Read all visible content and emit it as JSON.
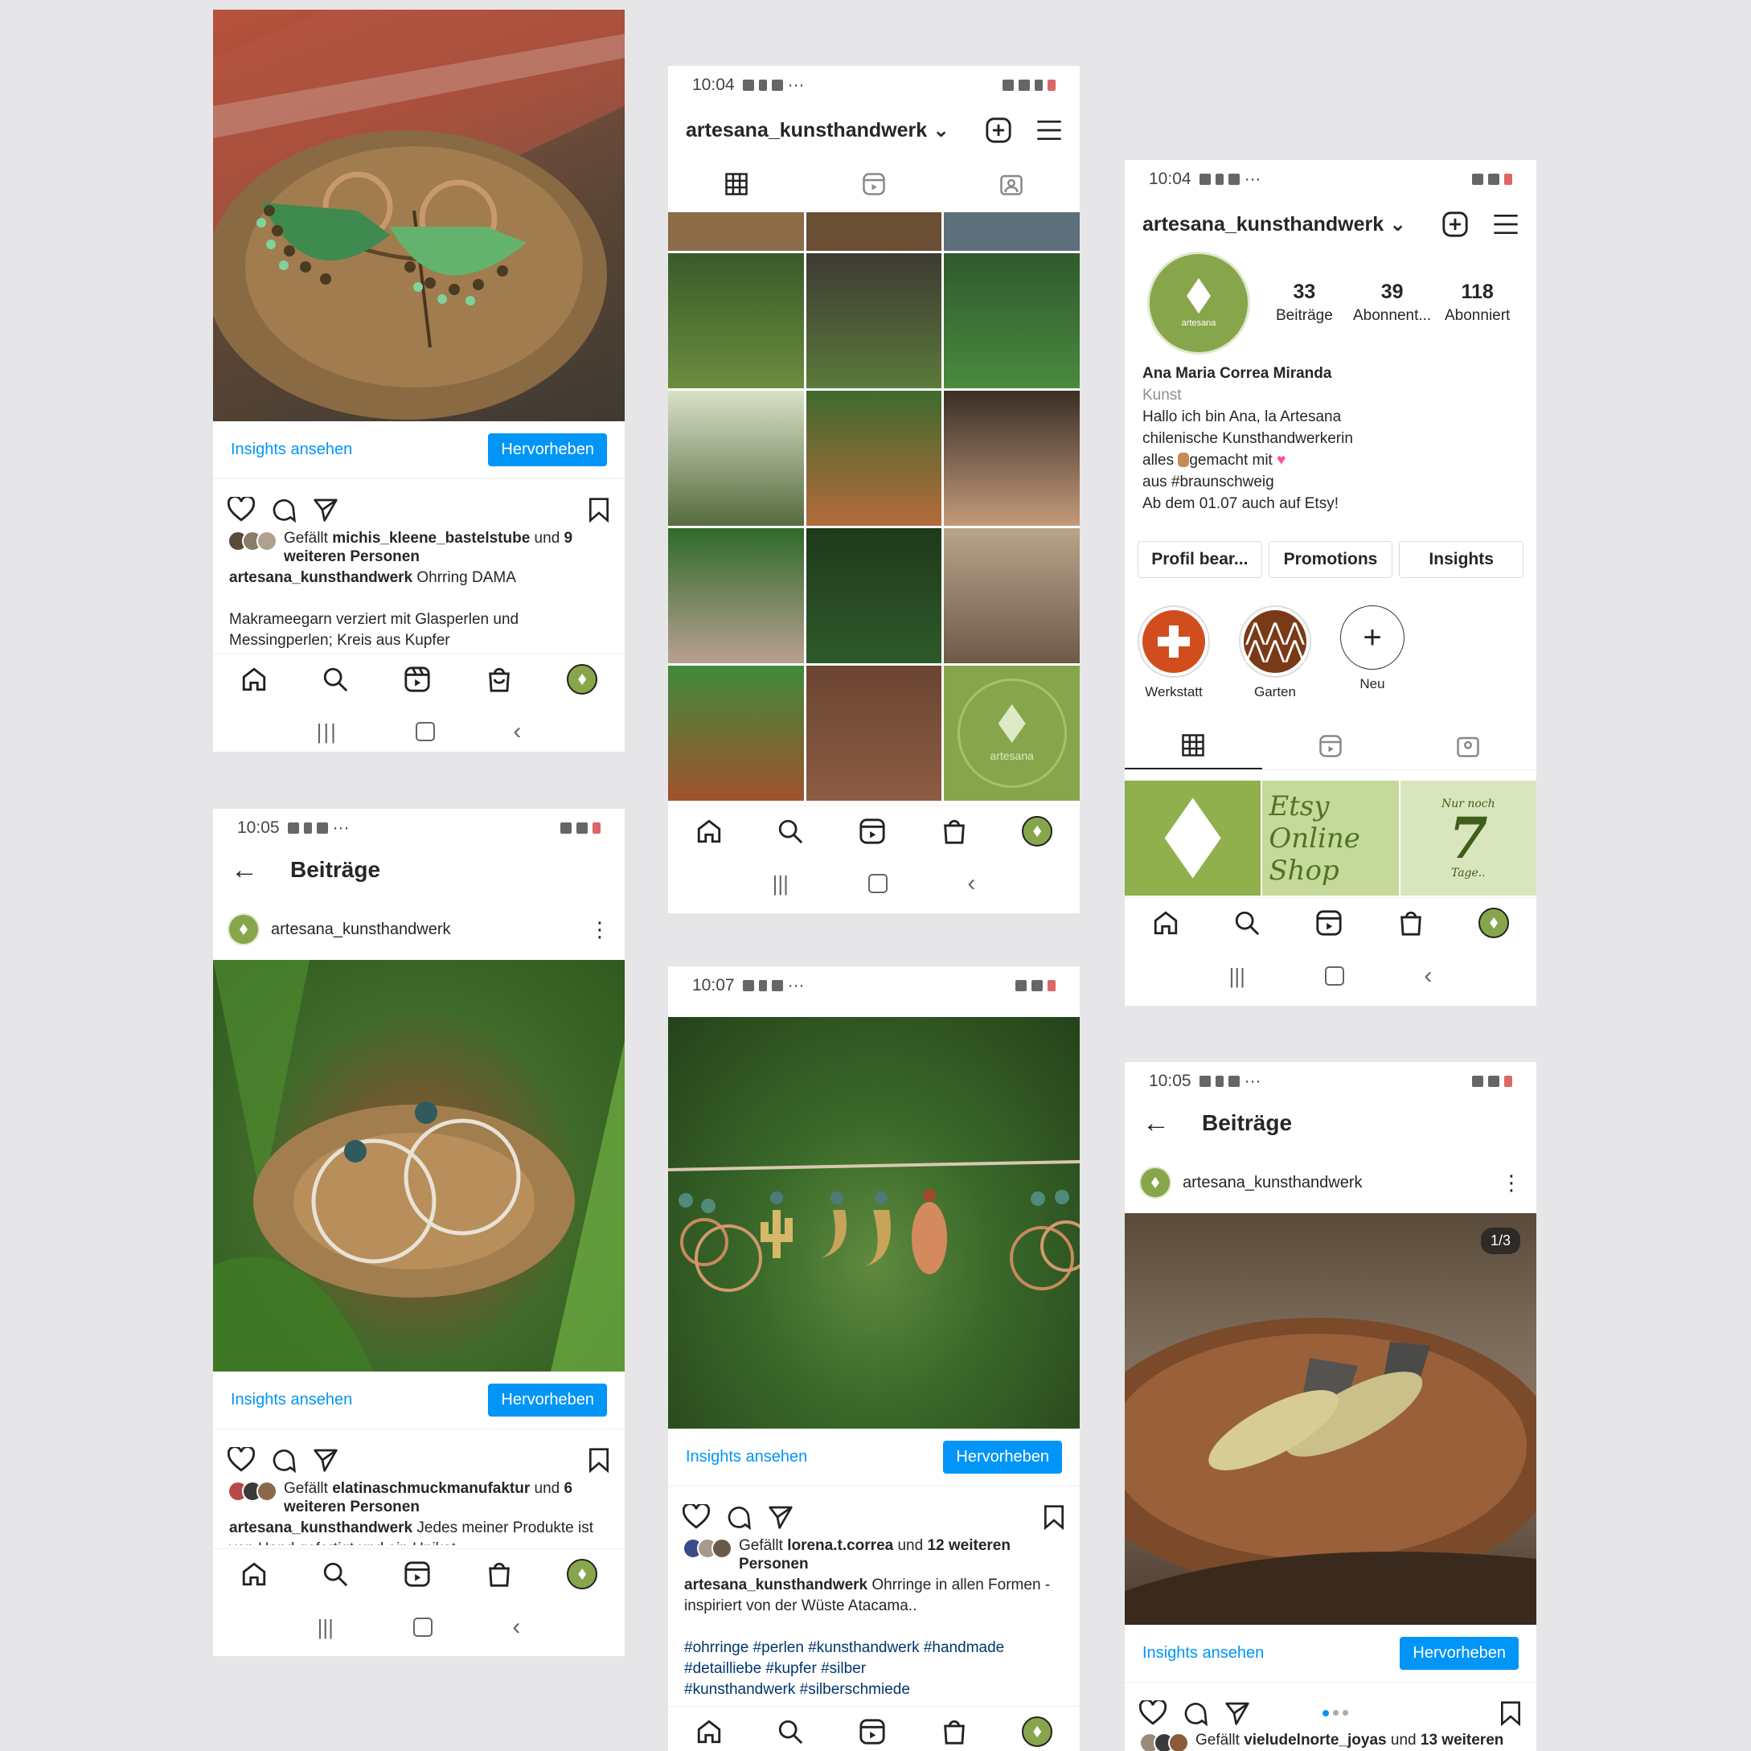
{
  "status": {
    "t1": "10:04",
    "t2": "10:04",
    "t3": "10:05",
    "t4": "10:07",
    "t5": "10:05",
    "dots": "···"
  },
  "post_actions": {
    "insights": "Insights ansehen",
    "boost": "Hervorheben"
  },
  "post1": {
    "likes_prefix": "Gefällt ",
    "likes_user": "michis_kleene_bastelstube",
    "likes_mid": " und ",
    "likes_rest": "9 weiteren Personen",
    "caption_user": "artesana_kunsthandwerk",
    "caption_text": " Ohrring DAMA",
    "caption_more": "Makrameegarn verziert mit Glasperlen und Messingperlen; Kreis aus Kupfer"
  },
  "profile": {
    "username": "artesana_kunsthandwerk",
    "logo_text": "artesana",
    "posts_count": "33",
    "posts_label": "Beiträge",
    "followers_count": "39",
    "followers_label": "Abonnent...",
    "following_count": "118",
    "following_label": "Abonniert",
    "name": "Ana Maria Correa Miranda",
    "category": "Kunst",
    "bio1": "Hallo ich bin Ana, la Artesana",
    "bio2": "chilenische Kunsthandwerkerin",
    "bio3_a": "alles ",
    "bio3_b": "gemacht mit ",
    "bio4": "aus #braunschweig",
    "bio5": "Ab dem 01.07 auch auf Etsy!",
    "btn_edit": "Profil bear...",
    "btn_promo": "Promotions",
    "btn_insights": "Insights",
    "highlights": [
      "Werkstatt",
      "Garten",
      "Neu"
    ],
    "etsy1": "Etsy",
    "etsy2": "Online",
    "etsy3": "Shop",
    "nur_noch": "Nur noch",
    "days_num": "7",
    "days_label": "Tage.."
  },
  "beitraege": {
    "title": "Beiträge",
    "user": "artesana_kunsthandwerk"
  },
  "post2": {
    "likes_prefix": "Gefällt ",
    "likes_user": "elatinaschmuckmanufaktur",
    "likes_mid": " und ",
    "likes_rest": "6 weiteren Personen",
    "caption_user": "artesana_kunsthandwerk",
    "caption_text": " Jedes meiner Produkte",
    "caption_more": "ist von Hand gefertigt und ein Unikat"
  },
  "post3": {
    "likes_prefix": "Gefällt ",
    "likes_user": "lorena.t.correa",
    "likes_mid": " und ",
    "likes_rest": "12 weiteren Personen",
    "caption_user": "artesana_kunsthandwerk",
    "caption_text": " Ohrringe in allen Formen - inspiriert von der Wüste Atacama..",
    "hashtags1": "#ohrringe #perlen #kunsthandwerk #handmade",
    "hashtags2": "#detailliebe #kupfer #silber",
    "hashtags3": "#kunsthandwerk #silberschmiede"
  },
  "post4": {
    "counter": "1/3",
    "likes_prefix": "Gefällt ",
    "likes_user": "vieludelnorte_joyas",
    "likes_mid": " und ",
    "likes_rest": "13 weiteren"
  },
  "colors": {
    "accent": "#0095f6",
    "brand_green": "#87a64b",
    "bg": "#e6e6e8"
  }
}
